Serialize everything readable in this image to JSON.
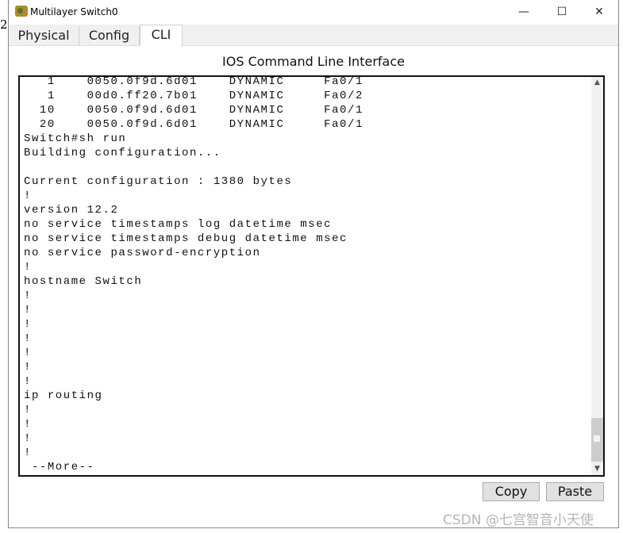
{
  "window": {
    "title": "Multilayer Switch0",
    "minimize": "—",
    "maximize": "☐",
    "close": "✕"
  },
  "tabs": [
    {
      "label": "Physical"
    },
    {
      "label": "Config"
    },
    {
      "label": "CLI",
      "active": true
    }
  ],
  "panel_title": "IOS Command Line Interface",
  "terminal_lines": [
    "   1    0050.0f9d.6d01    DYNAMIC     Fa0/1",
    "   1    00d0.ff20.7b01    DYNAMIC     Fa0/2",
    "  10    0050.0f9d.6d01    DYNAMIC     Fa0/1",
    "  20    0050.0f9d.6d01    DYNAMIC     Fa0/1",
    "Switch#sh run",
    "Building configuration...",
    "",
    "Current configuration : 1380 bytes",
    "!",
    "version 12.2",
    "no service timestamps log datetime msec",
    "no service timestamps debug datetime msec",
    "no service password-encryption",
    "!",
    "hostname Switch",
    "!",
    "!",
    "!",
    "!",
    "!",
    "!",
    "!",
    "ip routing",
    "!",
    "!",
    "!",
    "!",
    " --More--"
  ],
  "buttons": {
    "copy": "Copy",
    "paste": "Paste"
  },
  "watermark": "CSDN @七宫智音小天使",
  "background_fragment": "2"
}
